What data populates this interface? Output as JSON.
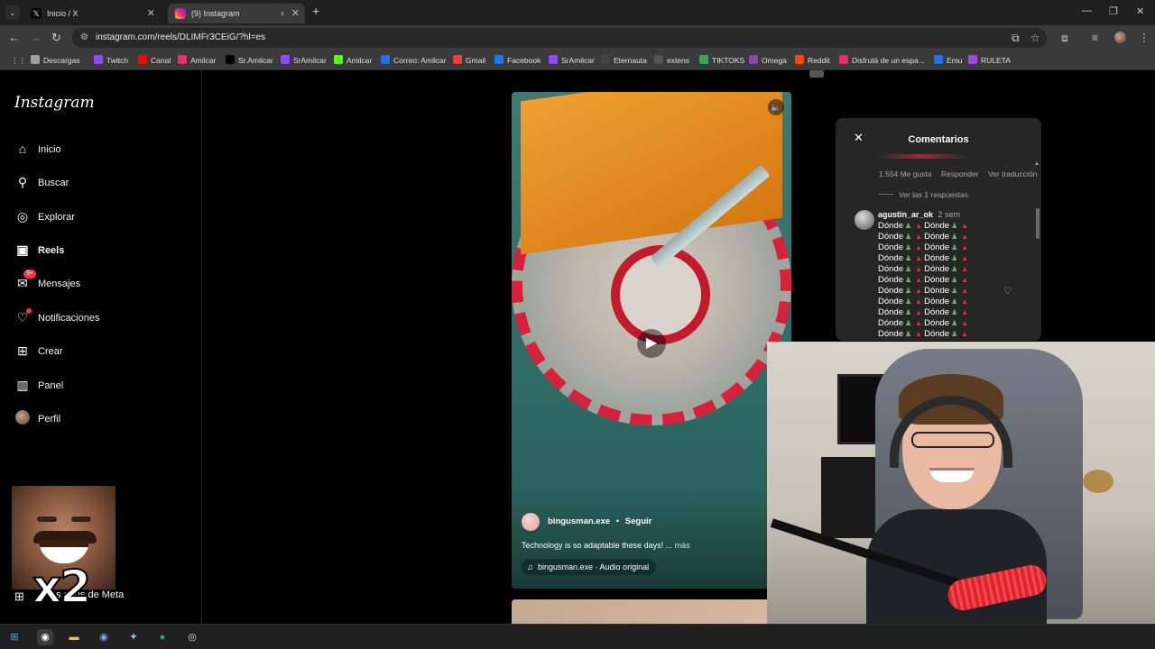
{
  "browser": {
    "tabs": [
      {
        "title": "Inicio / X",
        "icon": "x-logo-icon",
        "active": false
      },
      {
        "title": "(9) Instagram",
        "icon": "instagram-icon",
        "active": true
      }
    ],
    "url": "instagram.com/reels/DLIMFr3CEiG/?hl=es",
    "bookmarks": [
      "Descargas",
      "Twitch",
      "Canal",
      "Amilcar",
      "Sr.Amilcar",
      "SrAmilcar",
      "Amilcar",
      "Correo: Amilcar",
      "Gmail",
      "Facebook",
      "SrAmilcar",
      "Eternauta",
      "extens",
      "TIKTOKS",
      "Omega",
      "Reddit",
      "Disfrutá de un espa...",
      "Emu",
      "RULETA"
    ],
    "bookmark_colors": [
      "#9aa0a6",
      "#9146ff",
      "#ff0000",
      "#e1306c",
      "#000000",
      "#9146ff",
      "#53fc18",
      "#1a73e8",
      "#ea4335",
      "#1877f2",
      "#9146ff",
      "#444444",
      "#555555",
      "#34a853",
      "#8e44ad",
      "#ff4500",
      "#e1306c",
      "#1a73e8",
      "#a142f4"
    ]
  },
  "sidebar": {
    "logo": "Instagram",
    "items": [
      {
        "label": "Inicio",
        "icon": "home-icon"
      },
      {
        "label": "Buscar",
        "icon": "search-icon"
      },
      {
        "label": "Explorar",
        "icon": "compass-icon"
      },
      {
        "label": "Reels",
        "icon": "reels-icon"
      },
      {
        "label": "Mensajes",
        "icon": "messenger-icon"
      },
      {
        "label": "Notificaciones",
        "icon": "heart-icon"
      },
      {
        "label": "Crear",
        "icon": "plus-square-icon"
      },
      {
        "label": "Panel",
        "icon": "chart-icon"
      },
      {
        "label": "Perfil",
        "icon": "avatar"
      }
    ],
    "messages_badge": "9+",
    "meta_link": "s apps de Meta",
    "meme_overlay": "x2"
  },
  "reel": {
    "author": "bingusman.exe",
    "follow": "Seguir",
    "separator": "•",
    "caption": "Technology is so adaptable these days! ...",
    "more": "más",
    "audio": "bingusman.exe · Audio original"
  },
  "comments": {
    "title": "Comentarios",
    "likes": "1.554 Me gusta",
    "reply": "Responder",
    "translate": "Ver traducción",
    "view_replies": "Ver las 1 respuestas",
    "comment_user": "agustin_ar_ok",
    "comment_age": "2 sem",
    "word": "Dónde",
    "line_count": 11
  },
  "colors": {
    "accent_red": "#ff3040",
    "panel_bg": "#262626",
    "text_secondary": "#a8a8a8"
  }
}
